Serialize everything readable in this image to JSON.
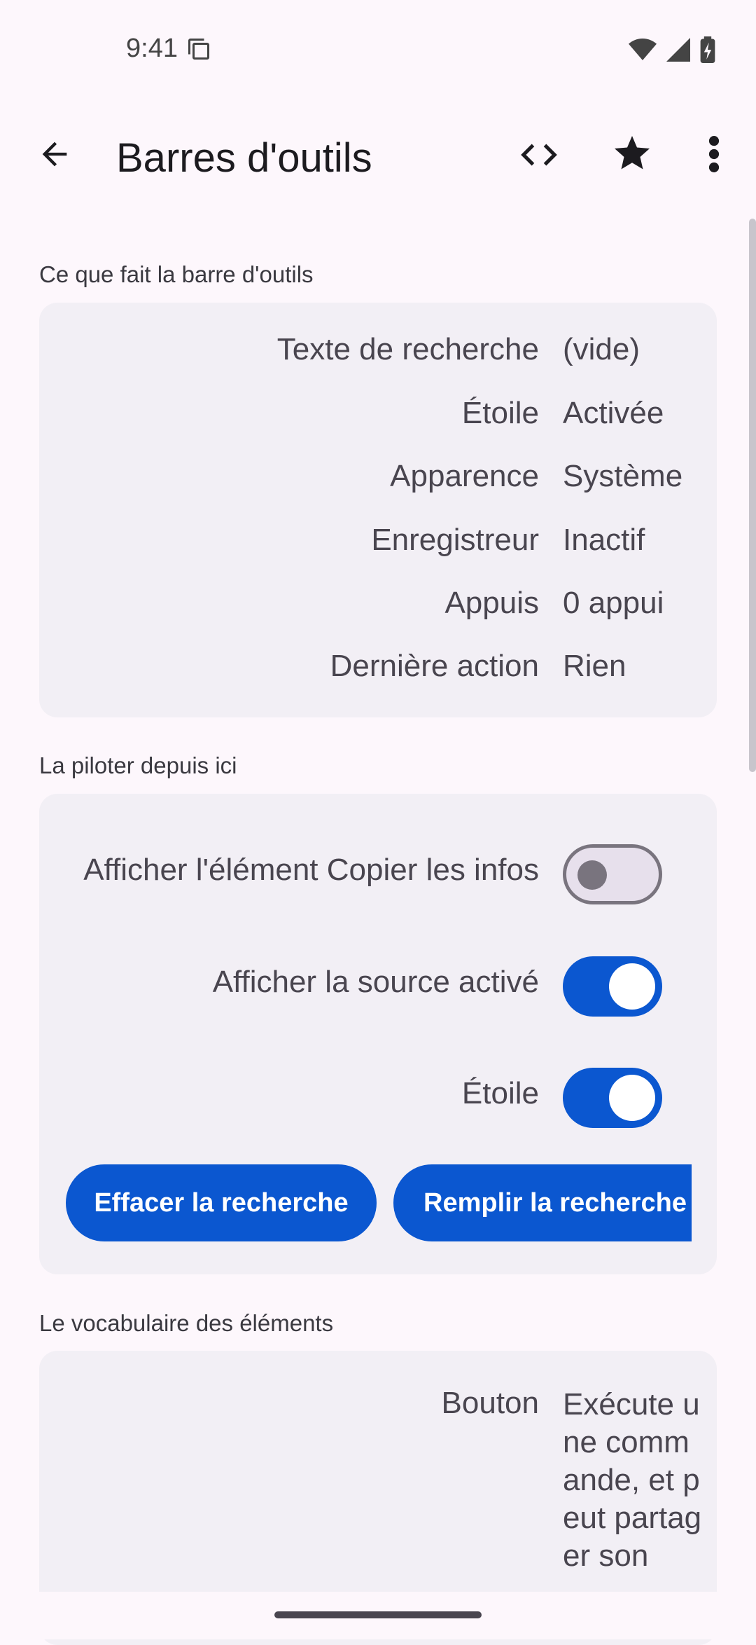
{
  "status_bar": {
    "time": "9:41",
    "icons": [
      "copy-icon",
      "wifi-icon",
      "signal-icon",
      "battery-charging-icon"
    ]
  },
  "app_bar": {
    "title": "Barres d'outils",
    "actions": [
      "back-arrow-icon",
      "code-icon",
      "star-icon",
      "more-vert-icon"
    ]
  },
  "section_status": {
    "label": "Ce que fait la barre d'outils",
    "rows": [
      {
        "key": "Texte de recherche",
        "value": "(vide)"
      },
      {
        "key": "Étoile",
        "value": "Activée"
      },
      {
        "key": "Apparence",
        "value": "Système"
      },
      {
        "key": "Enregistreur",
        "value": "Inactif"
      },
      {
        "key": "Appuis",
        "value": "0 appui"
      },
      {
        "key": "Dernière action",
        "value": "Rien"
      }
    ]
  },
  "section_controls": {
    "label": "La piloter depuis ici",
    "toggles": [
      {
        "label": "Afficher l'élément Copier les infos",
        "on": false
      },
      {
        "label": "Afficher la source activé",
        "on": true
      },
      {
        "label": "Étoile",
        "on": true
      }
    ],
    "buttons": [
      "Effacer la recherche",
      "Remplir la recherche"
    ]
  },
  "section_vocab": {
    "label": "Le vocabulaire des éléments",
    "rows": [
      {
        "key": "Bouton",
        "value": "Exécute une commande, et peut partager son"
      }
    ]
  },
  "colors": {
    "background": "#fdf7fc",
    "card": "#f2eff5",
    "accent": "#0b57d0",
    "text": "#49454f"
  }
}
